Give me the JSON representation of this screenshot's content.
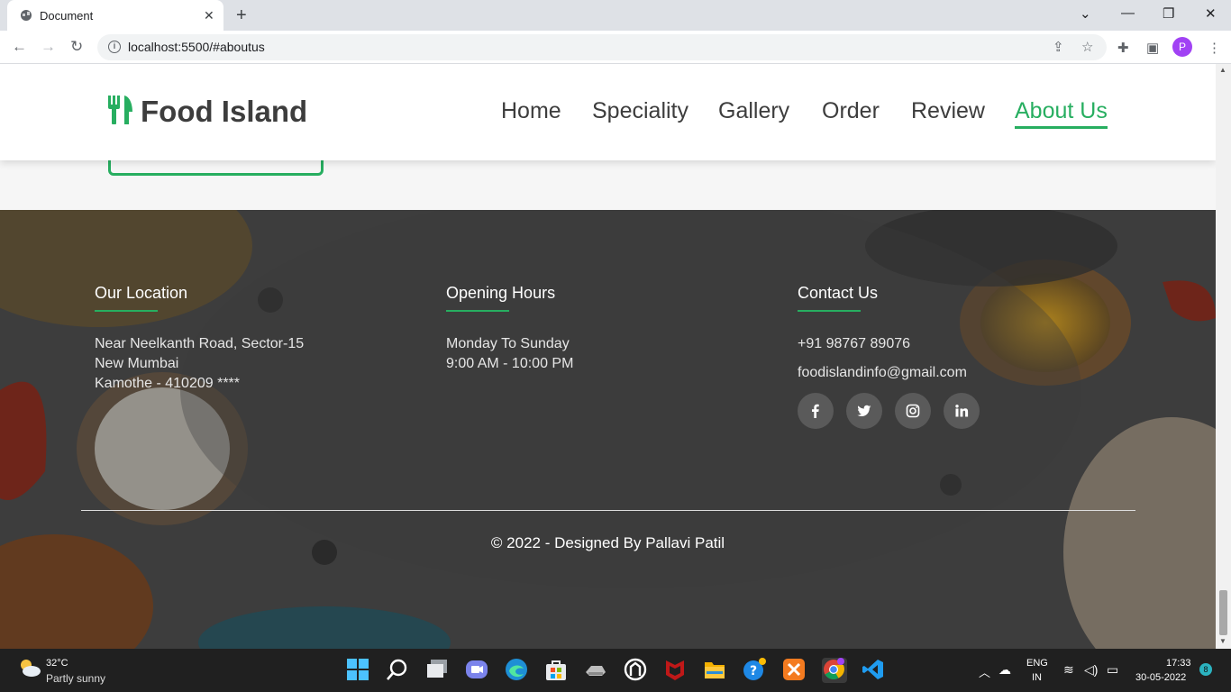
{
  "browser": {
    "tab_title": "Document",
    "url": "localhost:5500/#aboutus",
    "profile_initial": "P"
  },
  "site": {
    "brand": "Food Island",
    "nav": [
      "Home",
      "Speciality",
      "Gallery",
      "Order",
      "Review",
      "About Us"
    ],
    "active_nav": "About Us",
    "accent_color": "#27ae60"
  },
  "footer": {
    "location": {
      "title": "Our Location",
      "lines": [
        "Near Neelkanth Road, Sector-15",
        "New Mumbai",
        "Kamothe - 410209 ****"
      ]
    },
    "hours": {
      "title": "Opening Hours",
      "lines": [
        "Monday To Sunday",
        "9:00 AM - 10:00 PM"
      ]
    },
    "contact": {
      "title": "Contact Us",
      "phone": "+91 98767 89076",
      "email": "foodislandinfo@gmail.com",
      "social": [
        "facebook-icon",
        "twitter-icon",
        "instagram-icon",
        "linkedin-icon"
      ]
    },
    "copyright": "© 2022 - Designed By Pallavi Patil"
  },
  "taskbar": {
    "temperature": "32°C",
    "weather": "Partly sunny",
    "lang": "ENG",
    "region": "IN",
    "time": "17:33",
    "date": "30-05-2022",
    "notifications": "8"
  }
}
